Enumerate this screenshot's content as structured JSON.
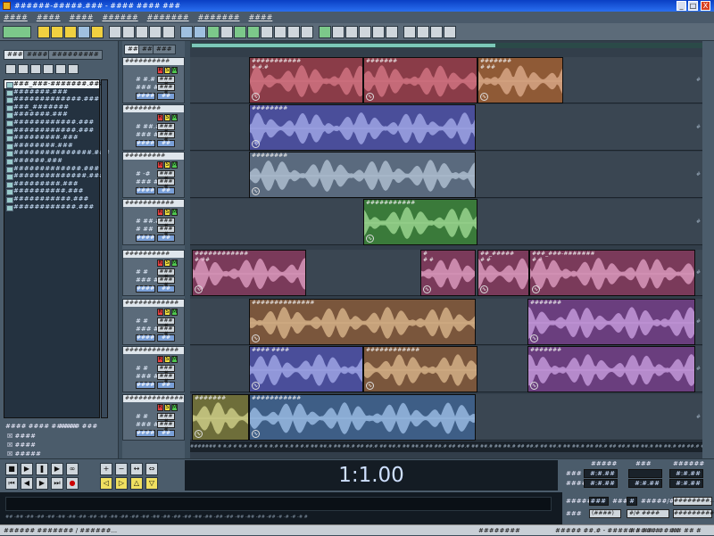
{
  "title": "######-#####.### - #### #### ###",
  "window_buttons": [
    "_",
    "□",
    "X"
  ],
  "menu": [
    "####",
    "####",
    "####",
    "######",
    "#######",
    "#######",
    "####"
  ],
  "left_tabs": [
    "#####",
    "#######",
    "#########"
  ],
  "files": [
    "###_###-#######.###",
    "#######.###",
    "#############.###",
    "###_#######",
    "#######.###",
    "############.###",
    "############.###",
    "#########.###",
    "########.###",
    "###############.###",
    "######.###",
    "#############.###",
    "##############.###",
    "#########.###",
    "##########.###",
    "###########.###",
    "############.###"
  ],
  "show_file_types": "#### #### #####",
  "sort_by": "#### ###",
  "file_types": [
    "####",
    "####",
    "#####"
  ],
  "sort_value": "###### ####",
  "auto_play": "#### ####",
  "full_paths": "#### #####",
  "track_tabs": [
    "###",
    "###",
    "###"
  ],
  "tracks": [
    {
      "name": "##########",
      "vol": "# #.#",
      "pan": "### #",
      "out": "### #",
      "lock": "####",
      "fx": "##"
    },
    {
      "name": "########",
      "vol": "# ##.#",
      "pan": "### #",
      "out": "### #",
      "lock": "####",
      "fx": "##"
    },
    {
      "name": "#########",
      "vol": "# -#",
      "pan": "### #",
      "out": "### #",
      "lock": "####",
      "fx": "##"
    },
    {
      "name": "###########",
      "vol": "# ##.#",
      "pan": "# ##",
      "out": "### #",
      "lock": "####",
      "fx": "##"
    },
    {
      "name": "##########",
      "vol": "# #",
      "pan": "### #",
      "out": "### #",
      "lock": "####",
      "fx": "##"
    },
    {
      "name": "############",
      "vol": "# #",
      "pan": "### #",
      "out": "### #",
      "lock": "####",
      "fx": "##"
    },
    {
      "name": "############",
      "vol": "# #",
      "pan": "### #",
      "out": "### #",
      "lock": "####",
      "fx": "##"
    },
    {
      "name": "###############",
      "vol": "# #",
      "pan": "### #",
      "out": "### #",
      "lock": "####",
      "fx": "##"
    }
  ],
  "clips": [
    {
      "lane": 0,
      "name": "###########",
      "vol": "# #.#",
      "color": "#8a3c48",
      "wave": "#d87a88"
    },
    {
      "lane": 0,
      "name": "#######",
      "vol": "",
      "color": "#8a3c48",
      "wave": "#d87a88"
    },
    {
      "lane": 0,
      "name": "#######",
      "vol": "# ##",
      "color": "#8f5a36",
      "wave": "#e0b090"
    },
    {
      "lane": 1,
      "name": "########",
      "vol": "",
      "color": "#4a4e9a",
      "wave": "#aab0ee"
    },
    {
      "lane": 2,
      "name": "########",
      "vol": "",
      "color": "#5a6a7e",
      "wave": "#b8c8da"
    },
    {
      "lane": 3,
      "name": "###########",
      "vol": "",
      "color": "#3a7a3a",
      "wave": "#a6e09a"
    },
    {
      "lane": 4,
      "name": "############",
      "vol": "# ##",
      "color": "#7a3a5a",
      "wave": "#e6a4c8"
    },
    {
      "lane": 4,
      "name": "#",
      "vol": "# #",
      "color": "#7a3a5a",
      "wave": "#e6a4c8"
    },
    {
      "lane": 4,
      "name": "##_#####",
      "vol": "# #",
      "color": "#7a3a5a",
      "wave": "#e6a4c8"
    },
    {
      "lane": 4,
      "name": "###_###-#######",
      "vol": "# #",
      "color": "#7a3a5a",
      "wave": "#e6a4c8"
    },
    {
      "lane": 5,
      "name": "##############",
      "vol": "",
      "color": "#7a563c",
      "wave": "#e0bc90"
    },
    {
      "lane": 5,
      "name": "#######",
      "vol": "",
      "color": "#6a3e7e",
      "wave": "#cfa4e6"
    },
    {
      "lane": 6,
      "name": "#### ####",
      "vol": "",
      "color": "#4a4e9a",
      "wave": "#aab0ee"
    },
    {
      "lane": 6,
      "name": "############",
      "vol": "",
      "color": "#7a563c",
      "wave": "#e0bc90"
    },
    {
      "lane": 6,
      "name": "#######",
      "vol": "",
      "color": "#6a3e7e",
      "wave": "#cfa4e6"
    },
    {
      "lane": 7,
      "name": "#######",
      "vol": "",
      "color": "#6e6e3a",
      "wave": "#d8d890"
    },
    {
      "lane": 7,
      "name": "###########",
      "vol": "",
      "color": "#3e5e86",
      "wave": "#a4c6ec"
    }
  ],
  "track_numbers": [
    "#",
    "#",
    "#",
    "#",
    "#",
    "#",
    "#",
    "#"
  ],
  "ruler": "####### # #.# # #.# # #.# # #.# # #.# # #.# ## ##.# ## ##.# ## ##.# ## ##.# ## ##.# ## ##.# ## ##.# ## ##.# ## ##.# ## ##.# ## ##.# ## ##.# ## ##.# ## ##.# ## ##.# ## ##.# ## ##.# ## ##.# ##",
  "time_display": "1:1.00",
  "sel": {
    "begin_label": "#####",
    "end_label": "###",
    "length_label": "######",
    "sel_label": "###",
    "view_label": "####",
    "sel_begin": "#:#.##",
    "sel_end": "",
    "sel_length": "#:#.##",
    "view_begin": "#:#.##",
    "view_end": "#:#.##",
    "view_length": "#:#.##"
  },
  "level_scale": "## -## -## -## -## -## -## -## -## -## -## -## -## -## -## -## -## -## -## -## -## -## -## -## -## -## -# -# -# -# #",
  "tempo": {
    "tempo_label": "#####",
    "tempo_value": "###",
    "bpm_label": "###",
    "beats_value": "#",
    "beats_label": "#####/###",
    "advanced": "########...",
    "key_label": "###",
    "key_value": "(####)",
    "time_sig": "#/# ####",
    "metronome": "#########"
  },
  "status": {
    "left": "###### ####### / ######...",
    "middle": "########",
    "right1": "##### ##.# - ##### #### ####",
    "right2": "## ## #",
    "right3": "## ## #"
  }
}
